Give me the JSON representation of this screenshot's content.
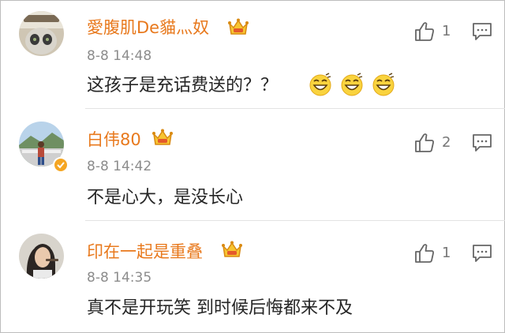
{
  "comments": [
    {
      "username": "愛腹肌De貓灬奴",
      "time": "8-8 14:48",
      "text": "这孩子是充话费送的？？",
      "emoji_count": 3,
      "emoji_name": "grinning-face-emoji",
      "likes": "1",
      "verified": false
    },
    {
      "username": "白伟80",
      "time": "8-8 14:42",
      "text": "不是心大，是没长心",
      "likes": "2",
      "verified": true
    },
    {
      "username": "印在一起是重叠",
      "time": "8-8 14:35",
      "text": "真不是开玩笑 到时候后悔都来不及",
      "likes": "1",
      "verified": false
    }
  ],
  "colors": {
    "username": "#e8791d",
    "timestamp": "#8c8c8c",
    "text": "#262626",
    "badge": "#f5a623",
    "separator": "#e3e3e3"
  },
  "icons": {
    "vip": "crown-icon",
    "like": "thumbs-up-icon",
    "reply": "comment-bubble-icon",
    "verified": "verified-badge-icon"
  }
}
